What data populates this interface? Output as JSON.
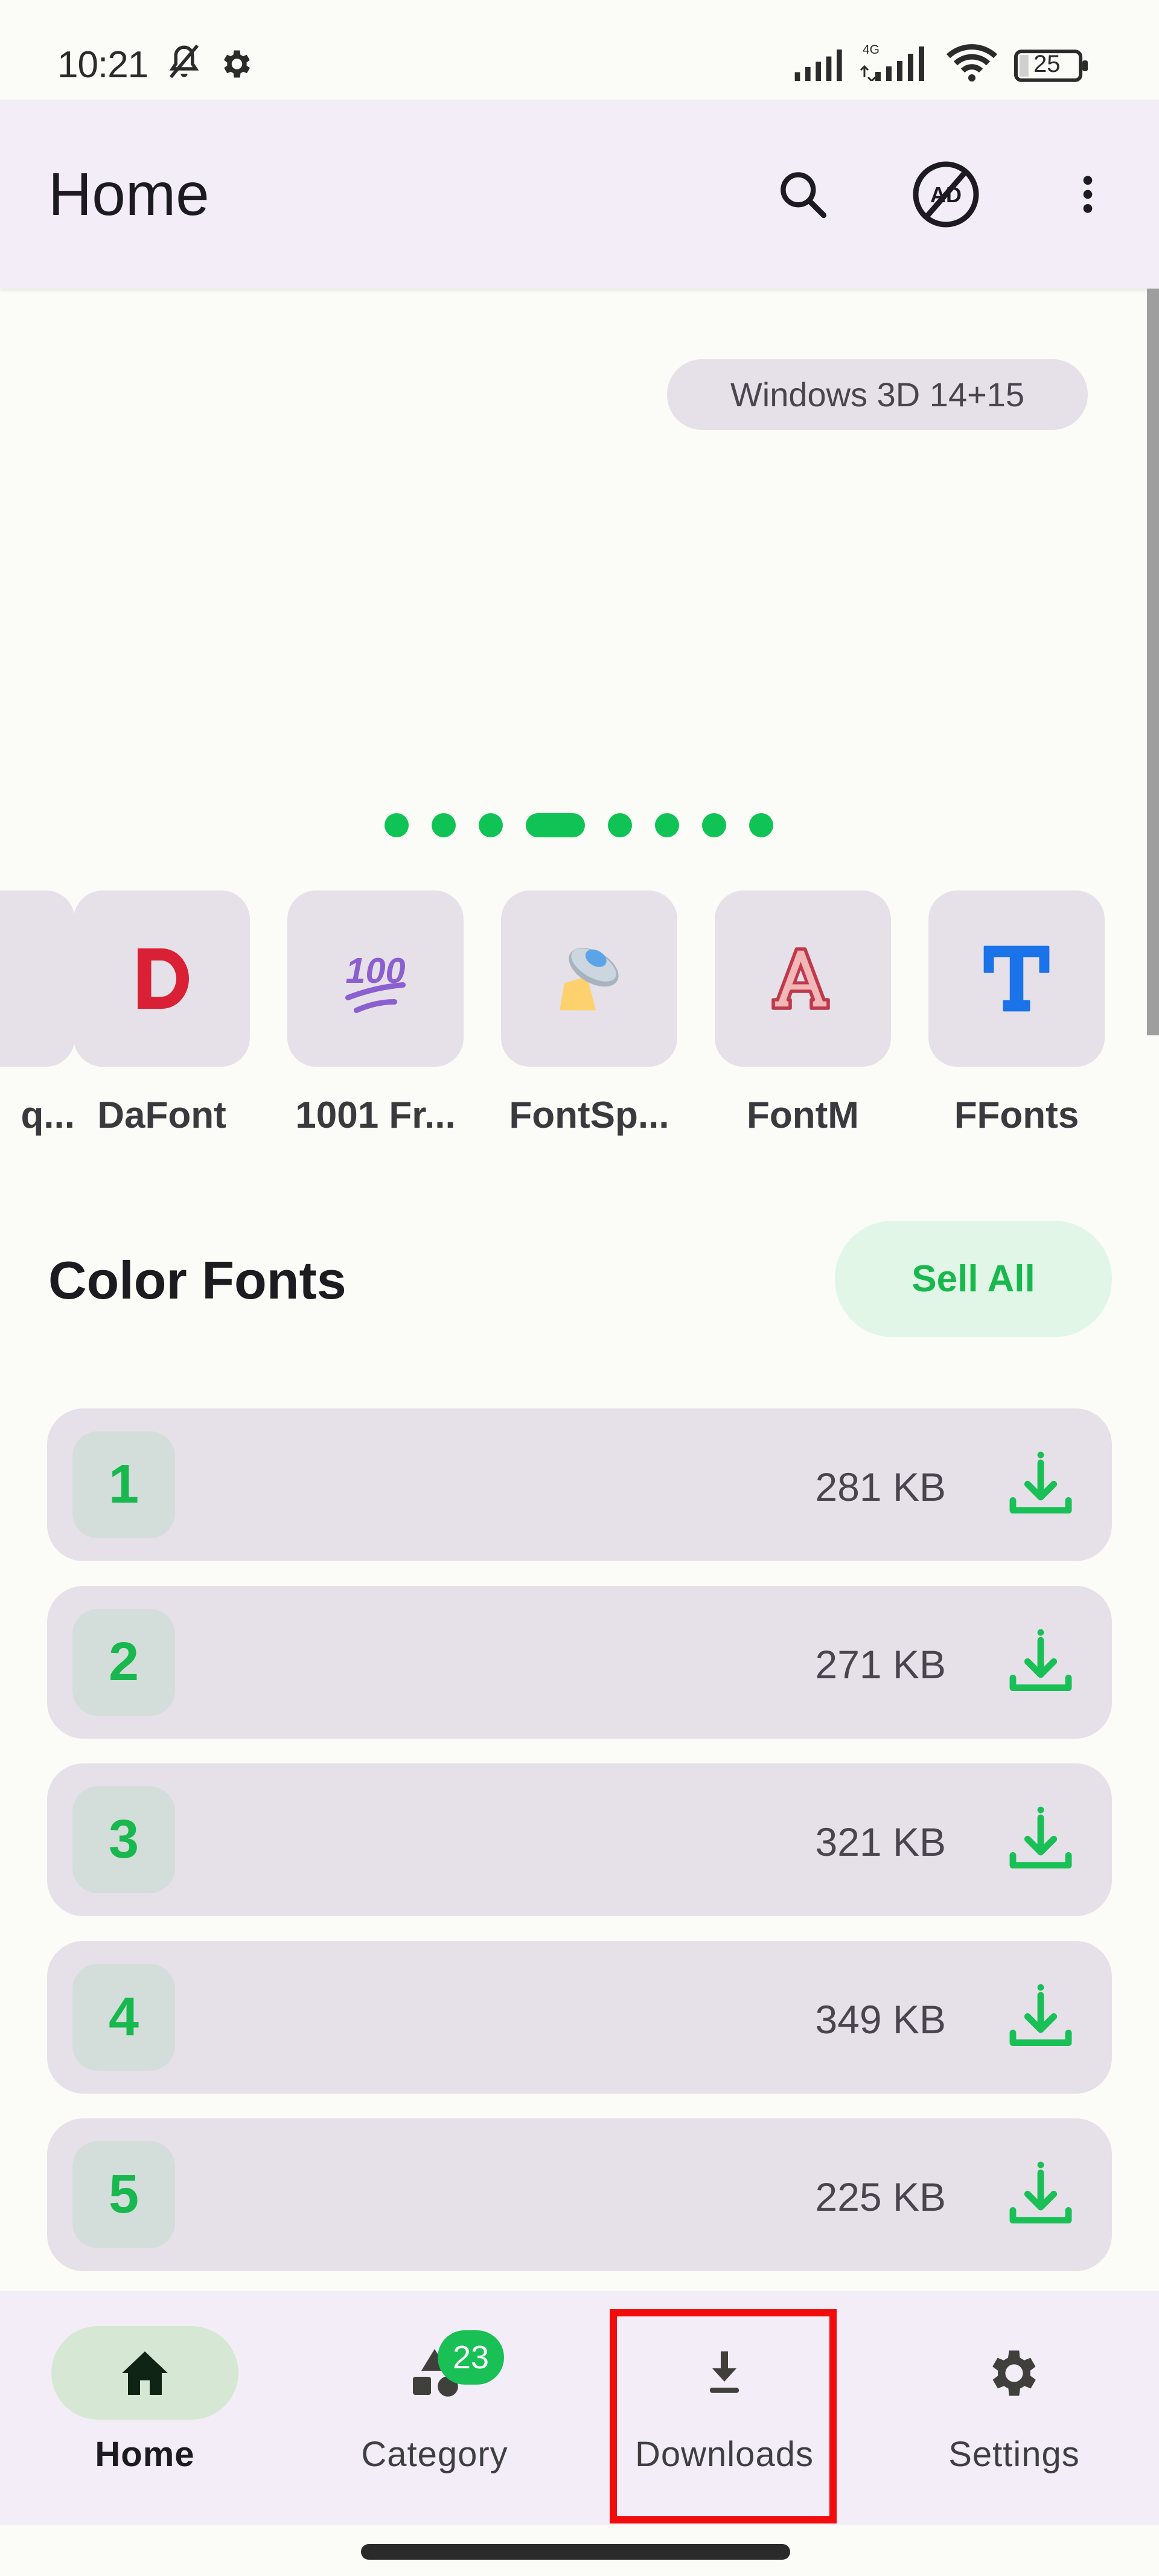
{
  "status_bar": {
    "time": "10:21",
    "network_label": "4G",
    "battery": "25",
    "icons": [
      "bell-off-icon",
      "gear-icon",
      "signal-icon",
      "signal-4g-icon",
      "wifi-icon",
      "battery-icon"
    ]
  },
  "app_bar": {
    "title": "Home",
    "actions": [
      {
        "name": "search",
        "icon": "search-icon"
      },
      {
        "name": "remove-ads",
        "icon": "no-ads-icon",
        "label": "AD"
      },
      {
        "name": "more",
        "icon": "more-vert-icon"
      }
    ]
  },
  "banner": {
    "chip_label": "Windows 3D 14+15",
    "page_count": 8,
    "active_page_index": 3
  },
  "sources": [
    {
      "label": "q...",
      "icon": "partial-source-icon"
    },
    {
      "label": "DaFont",
      "icon": "letter-d-icon",
      "color": "#d92035"
    },
    {
      "label": "1001 Fr...",
      "icon": "hundred-points-icon",
      "color": "#8b5fd0"
    },
    {
      "label": "FontSp...",
      "icon": "ufo-icon"
    },
    {
      "label": "FontM",
      "icon": "letter-a-outline-icon",
      "color": "#c0394a"
    },
    {
      "label": "FFonts",
      "icon": "letter-t-icon",
      "color": "#1a73e8"
    }
  ],
  "section": {
    "title": "Color Fonts",
    "see_all_label": "Sell All"
  },
  "fonts": [
    {
      "number": "1",
      "size": "281 KB"
    },
    {
      "number": "2",
      "size": "271 KB"
    },
    {
      "number": "3",
      "size": "321 KB"
    },
    {
      "number": "4",
      "size": "349 KB"
    },
    {
      "number": "5",
      "size": "225 KB"
    }
  ],
  "bottom_nav": {
    "items": [
      {
        "label": "Home",
        "icon": "home-icon",
        "active": true
      },
      {
        "label": "Category",
        "icon": "category-icon",
        "badge": "23"
      },
      {
        "label": "Downloads",
        "icon": "download-icon",
        "highlighted": true
      },
      {
        "label": "Settings",
        "icon": "settings-icon"
      }
    ]
  },
  "colors": {
    "accent": "#18b84f",
    "surface": "#f3edf7",
    "card": "#e6e0e9",
    "background": "#fbfcf7",
    "highlight": "#f20c0c"
  }
}
